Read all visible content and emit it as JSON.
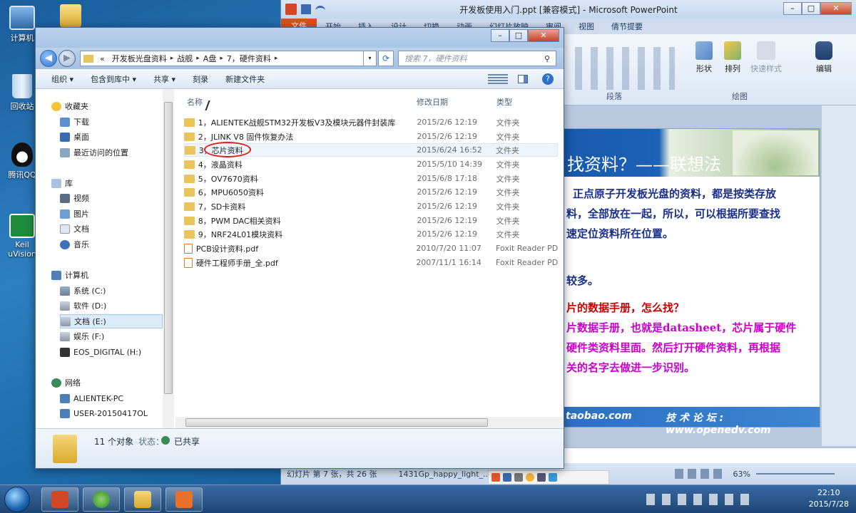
{
  "desktop": {
    "icons": [
      {
        "label": "计算机"
      },
      {
        "label": "回收站"
      },
      {
        "label": "腾讯QQ"
      },
      {
        "label": "Keil uVision"
      }
    ]
  },
  "powerpoint": {
    "title": "开发板使用入门.ppt [兼容模式] - Microsoft PowerPoint",
    "tabs": [
      "文件",
      "开始",
      "插入",
      "设计",
      "切换",
      "动画",
      "幻灯片放映",
      "审阅",
      "视图",
      "倩节提要"
    ],
    "ribbon": {
      "shape_label": "形状",
      "arrange_label": "排列",
      "quick_styles_label": "快速样式",
      "edit_label": "编辑",
      "paragraph_group": "段落",
      "drawing_group": "绘图"
    },
    "slide": {
      "title": "找资料？——联想法",
      "lines": [
        "正点原子开发板光盘的资料，都是按类存放",
        "料，全部放在一起，所以，可以根据所要查找",
        "速定位资料所在位置。",
        "较多。",
        "片的数据手册，怎么找？",
        "片数据手册，也就是datasheet，芯片属于硬件",
        "硬件类资料里面。然后打开硬件资料，再根据",
        "关的名字去做进一步识别。"
      ],
      "footer_left": "taobao.com",
      "footer_right": "技 术 论 坛 : www.openedv.com"
    },
    "status": {
      "slide_info": "幻灯片 第 7 张，共 26 张",
      "theme": "1431Gp_happy_light_...",
      "zoom": "63%"
    },
    "colors": {
      "slide_title_bg": "#1b62b8",
      "text_blue": "#1a2f8a",
      "text_red": "#cc0000",
      "text_magenta": "#cc00cc"
    }
  },
  "explorer": {
    "breadcrumb": [
      "«",
      "开发板光盘资料",
      "战舰",
      "A盘",
      "7，硬件资料"
    ],
    "search_placeholder": "搜索 7，硬件资料",
    "commands": [
      "组织 ▾",
      "包含到库中 ▾",
      "共享 ▾",
      "刻录",
      "新建文件夹"
    ],
    "nav": {
      "favorites": "收藏夹",
      "downloads": "下载",
      "desktop": "桌面",
      "recent": "最近访问的位置",
      "libraries": "库",
      "videos": "视频",
      "pictures": "图片",
      "documents": "文档",
      "music": "音乐",
      "computer": "计算机",
      "drive_c": "系统 (C:)",
      "drive_d": "软件 (D:)",
      "drive_e": "文档 (E:)",
      "drive_f": "娱乐 (F:)",
      "drive_h": "EOS_DIGITAL (H:)",
      "network": "网络",
      "pc1": "ALIENTEK-PC",
      "pc2": "USER-20150417OL"
    },
    "columns": {
      "name": "名称",
      "date": "修改日期",
      "type": "类型"
    },
    "files": [
      {
        "name": "1，ALIENTEK战舰STM32开发板V3及模块元器件封装库",
        "date": "2015/2/6 12:19",
        "type": "文件夹",
        "kind": "folder"
      },
      {
        "name": "2，JLINK V8 固件恢复办法",
        "date": "2015/2/6 12:19",
        "type": "文件夹",
        "kind": "folder"
      },
      {
        "name": "3，芯片资料",
        "date": "2015/6/24 16:52",
        "type": "文件夹",
        "kind": "folder"
      },
      {
        "name": "4，液晶资料",
        "date": "2015/5/10 14:39",
        "type": "文件夹",
        "kind": "folder"
      },
      {
        "name": "5，OV7670资料",
        "date": "2015/6/8 17:18",
        "type": "文件夹",
        "kind": "folder"
      },
      {
        "name": "6，MPU6050资料",
        "date": "2015/2/6 12:19",
        "type": "文件夹",
        "kind": "folder"
      },
      {
        "name": "7，SD卡资料",
        "date": "2015/2/6 12:19",
        "type": "文件夹",
        "kind": "folder"
      },
      {
        "name": "8，PWM DAC相关资料",
        "date": "2015/2/6 12:19",
        "type": "文件夹",
        "kind": "folder"
      },
      {
        "name": "9，NRF24L01模块资料",
        "date": "2015/2/6 12:19",
        "type": "文件夹",
        "kind": "folder"
      },
      {
        "name": "PCB设计资料.pdf",
        "date": "2010/7/20 11:07",
        "type": "Foxit Reader PD",
        "kind": "pdf"
      },
      {
        "name": "硬件工程师手册_全.pdf",
        "date": "2007/11/1 16:14",
        "type": "Foxit Reader PD",
        "kind": "pdf"
      }
    ],
    "details": {
      "count": "11 个对象",
      "state_label": "状态：",
      "state_value": "已共享"
    }
  },
  "taskbar": {
    "time": "22:10",
    "date": "2015/7/28"
  }
}
